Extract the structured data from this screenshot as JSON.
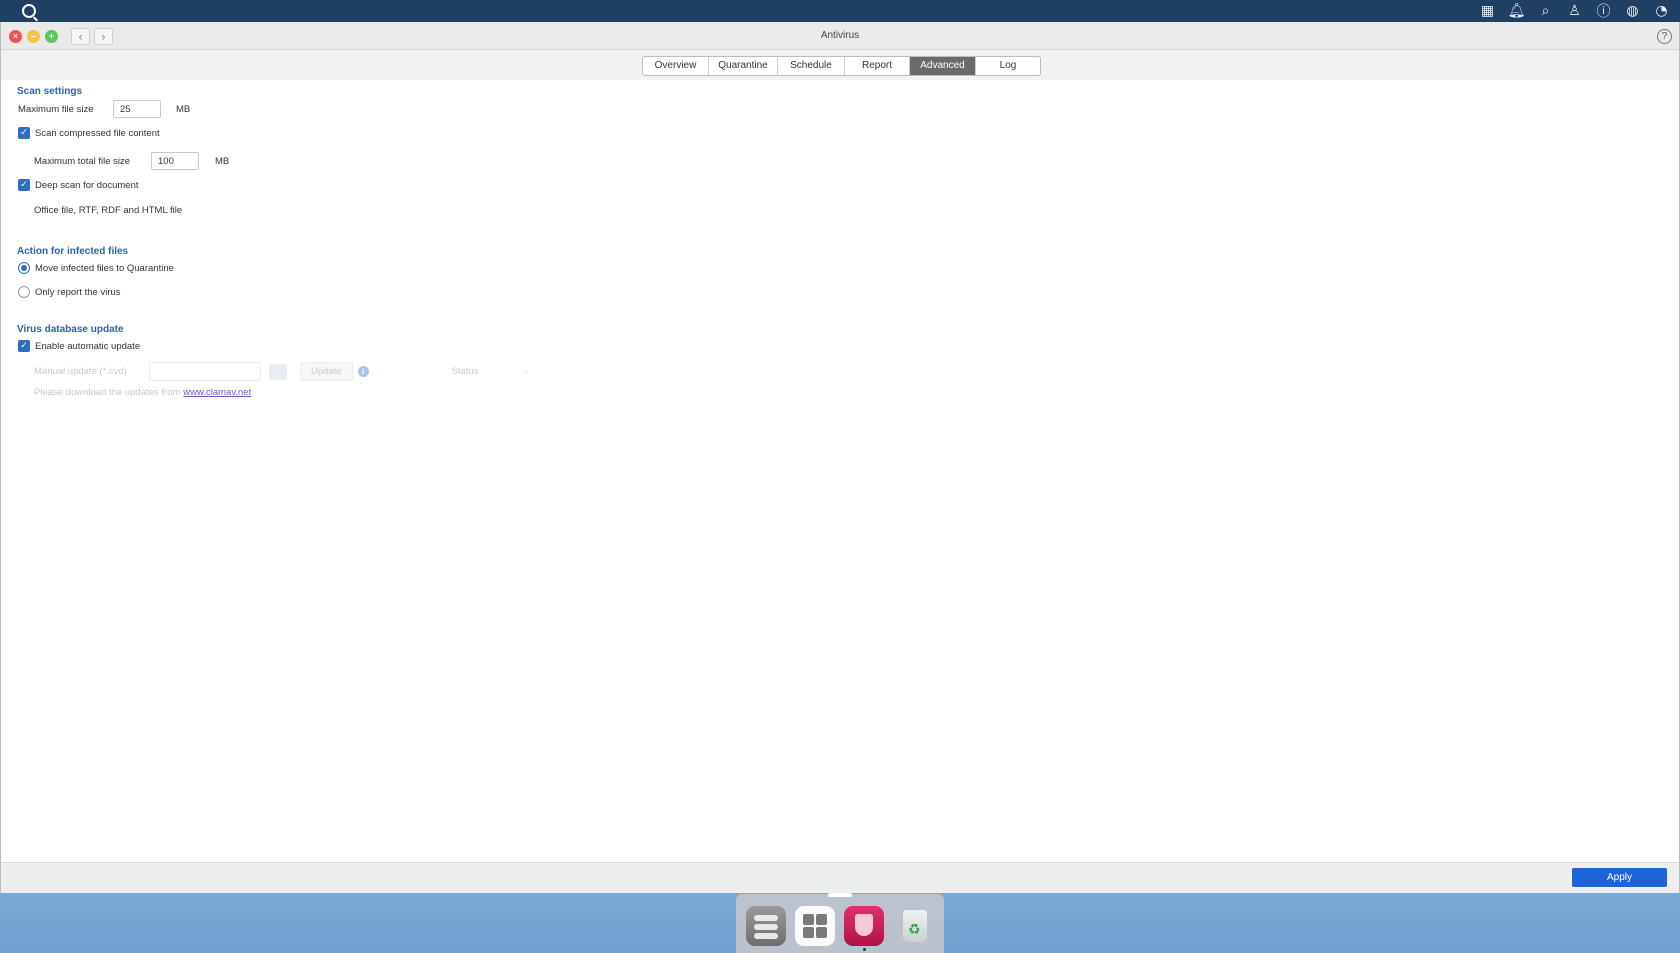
{
  "window": {
    "title": "Antivirus",
    "help_glyph": "?"
  },
  "topbar_icons": [
    "apps-grid-icon",
    "bell-icon",
    "search-icon",
    "user-icon",
    "help-icon",
    "globe-icon",
    "dashboard-icon"
  ],
  "tabs": [
    {
      "label": "Overview",
      "active": false
    },
    {
      "label": "Quarantine",
      "active": false
    },
    {
      "label": "Schedule",
      "active": false
    },
    {
      "label": "Report",
      "active": false
    },
    {
      "label": "Advanced",
      "active": true
    },
    {
      "label": "Log",
      "active": false
    }
  ],
  "scan_settings": {
    "title": "Scan settings",
    "max_file_size_label": "Maximum file size",
    "max_file_size_value": "25",
    "max_file_size_unit": "MB",
    "scan_compressed_label": "Scan compressed file content",
    "scan_compressed_checked": true,
    "max_total_label": "Maximum total file size",
    "max_total_value": "100",
    "max_total_unit": "MB",
    "deep_scan_label": "Deep scan for document",
    "deep_scan_checked": true,
    "deep_scan_note": "Office file, RTF, RDF and HTML file"
  },
  "action": {
    "title": "Action for infected files",
    "option_move": "Move infected files to Quarantine",
    "option_report": "Only report the virus",
    "selected": "move"
  },
  "virus_db": {
    "title": "Virus database update",
    "auto_update_label": "Enable automatic update",
    "auto_update_checked": true,
    "manual_label": "Manual update (*.cvd)",
    "update_button": "Update",
    "status_label": "Status",
    "status_value": "-",
    "download_note": "Please download the updates from",
    "download_link": "www.clamav.net"
  },
  "footer": {
    "apply_label": "Apply"
  },
  "dock": [
    "storage-manager-icon",
    "app-center-icon",
    "antivirus-shield-icon",
    "recycle-bin-icon"
  ]
}
